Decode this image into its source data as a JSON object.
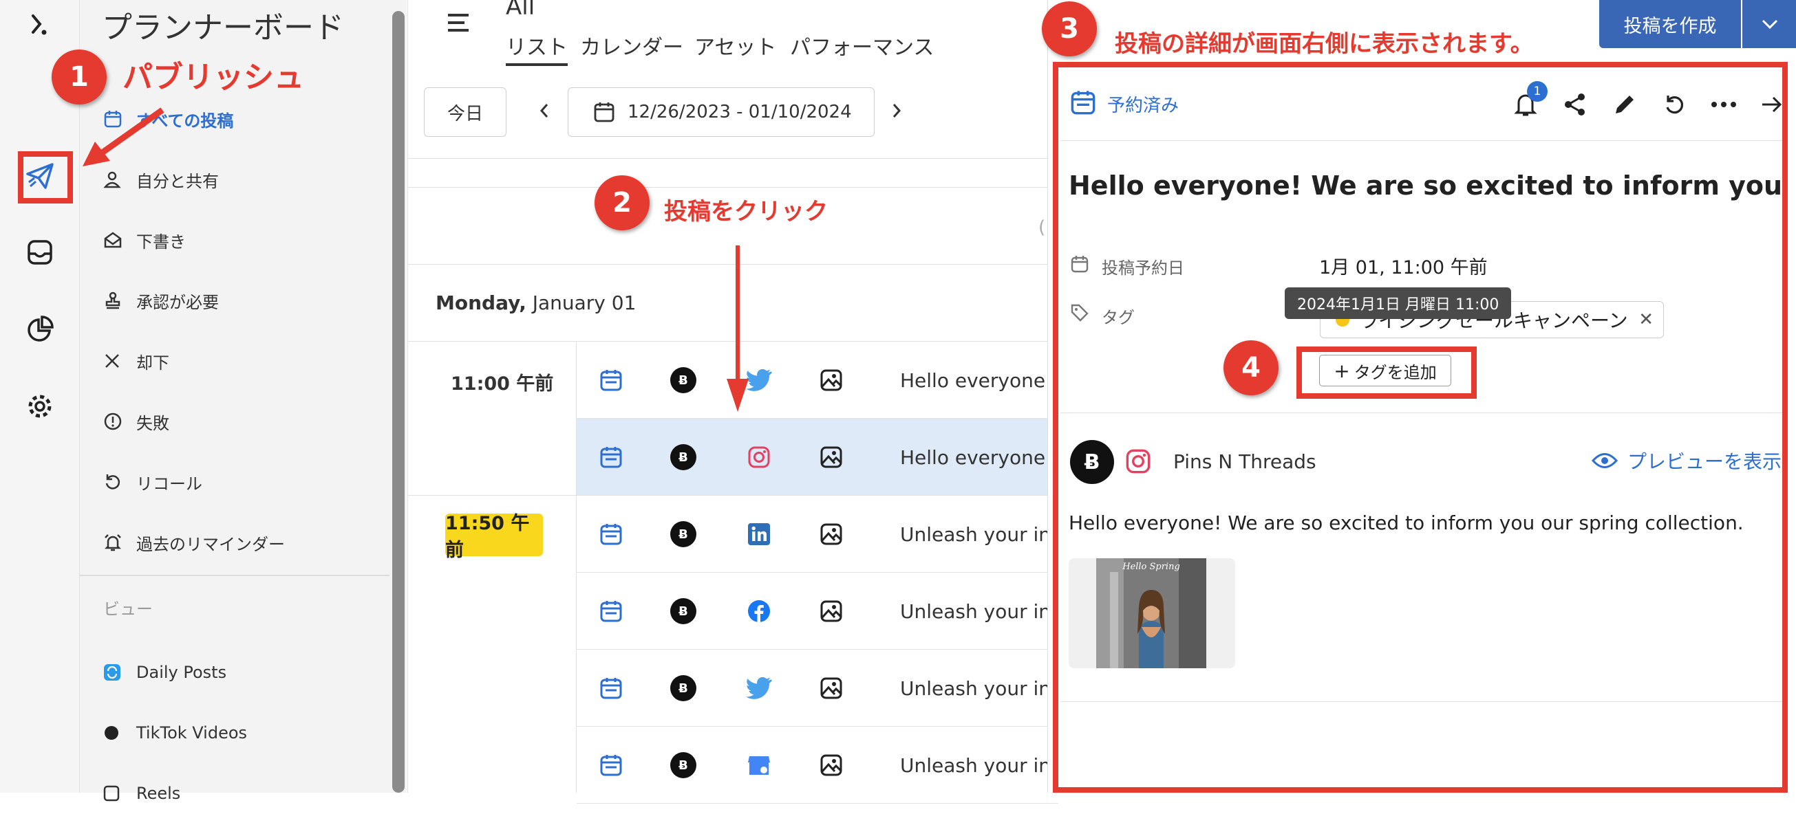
{
  "sidebar": {
    "title": "プランナーボード",
    "items": [
      {
        "label": "すべての投稿",
        "icon": "calendar-icon"
      },
      {
        "label": "自分と共有",
        "icon": "person-icon"
      },
      {
        "label": "下書き",
        "icon": "draft-icon"
      },
      {
        "label": "承認が必要",
        "icon": "stamp-icon"
      },
      {
        "label": "却下",
        "icon": "close-icon"
      },
      {
        "label": "失敗",
        "icon": "alert-icon"
      },
      {
        "label": "リコール",
        "icon": "recall-icon"
      },
      {
        "label": "過去のリマインダー",
        "icon": "alarm-icon"
      }
    ],
    "views_heading": "ビュー",
    "views": [
      {
        "label": "Daily Posts"
      },
      {
        "label": "TikTok Videos"
      },
      {
        "label": "Reels"
      }
    ]
  },
  "header": {
    "title": "All",
    "tabs": [
      "リスト",
      "カレンダー",
      "アセット",
      "パフォーマンス"
    ],
    "today_label": "今日",
    "date_range": "12/26/2023 - 01/10/2024",
    "create_label": "投稿を作成"
  },
  "list": {
    "day_bold": "Monday,",
    "day_rest": " January 01",
    "times": [
      "11:00 午前",
      "11:50 午前"
    ],
    "rows": [
      {
        "network": "twitter",
        "text": "Hello everyone!"
      },
      {
        "network": "instagram",
        "text": "Hello everyone!"
      },
      {
        "network": "linkedin",
        "text": "Unleash your in"
      },
      {
        "network": "facebook",
        "text": "Unleash your in"
      },
      {
        "network": "twitter",
        "text": "Unleash your in"
      },
      {
        "network": "gmb",
        "text": "Unleash your in"
      }
    ]
  },
  "detail": {
    "status": "予約済み",
    "notification_count": "1",
    "post_title": "Hello everyone! We are so excited to inform you our sp...",
    "schedule_label": "投稿予約日",
    "schedule_value": "1月 01, 11:00 午前",
    "tooltip": "2024年1月1日 月曜日 11:00",
    "tags_label": "タグ",
    "tag_value": "ライジングセールキャンペーン",
    "add_tag_label": "タグを追加",
    "account_name": "Pins N Threads",
    "preview_label": "プレビューを表示",
    "post_body": "Hello everyone! We are so excited to inform you our spring collection.",
    "thumbnail_text": "Hello Spring"
  },
  "annotations": {
    "step1_num": "1",
    "step1_text": "パブリッシュ",
    "step2_num": "2",
    "step2_text": "投稿をクリック",
    "step3_num": "3",
    "step3_text": "投稿の詳細が画面右側に表示されます。",
    "step4_num": "4"
  },
  "colors": {
    "accent": "#2d6fd1",
    "annotation_red": "#e53a2f",
    "selected_row": "#deeaf7",
    "time_highlight": "#f9d71c",
    "create_button": "#3a67b5"
  }
}
